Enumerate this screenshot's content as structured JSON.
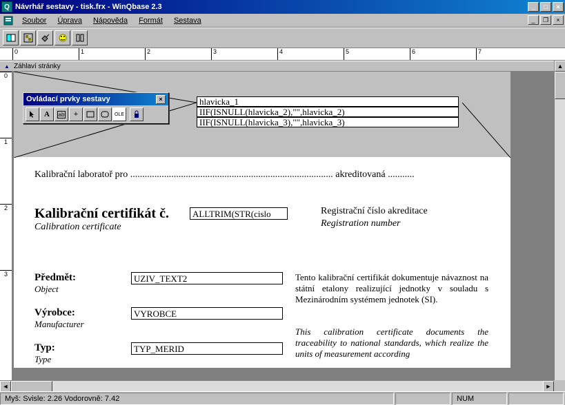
{
  "titlebar": {
    "text": "Návrhář sestavy - tisk.frx - WinQbase 2.3"
  },
  "menu": {
    "soubor": "Soubor",
    "uprava": "Úprava",
    "napoveda": "Nápověda",
    "format": "Formát",
    "sestava": "Sestava"
  },
  "band": {
    "header": "Záhlaví stránky"
  },
  "toolbox": {
    "title": "Ovládací prvky sestavy"
  },
  "expr": {
    "h1": "hlavicka_1",
    "h2": "IIF(ISNULL(hlavicka_2),\"\",hlavicka_2)",
    "h3": "IIF(ISNULL(hlavicka_3),\"\",hlavicka_3)"
  },
  "texts": {
    "lab_pro": "Kalibrační laboratoř pro",
    "dots": "....................................................................................",
    "akred": "akreditovaná",
    "dots2": "...........",
    "cert_title": "Kalibrační certifikát č.",
    "cert_sub": "Calibration certificate",
    "cert_field": "ALLTRIM(STR(cislo",
    "reg_title": "Registrační číslo akreditace",
    "reg_sub": "Registration number",
    "predmet": "Předmět:",
    "object": "Object",
    "uziv": "UZIV_TEXT2",
    "vyrobce": "Výrobce:",
    "manufacturer": "Manufacturer",
    "vyrobce_f": "VYROBCE",
    "typ": "Typ:",
    "type": "Type",
    "typ_f": "TYP_MERID",
    "para1": "Tento kalibrační certifikát dokumentuje návaznost na státní etalony realizující jednotky v souladu s Mezinárodním systémem jednotek (SI).",
    "para2": "This calibration certificate documents the traceability to national standards, which realize the units of measurement according"
  },
  "status": {
    "mouse": "Myš:  Svisle: 2.26  Vodorovně: 7.42",
    "num": "NUM"
  }
}
